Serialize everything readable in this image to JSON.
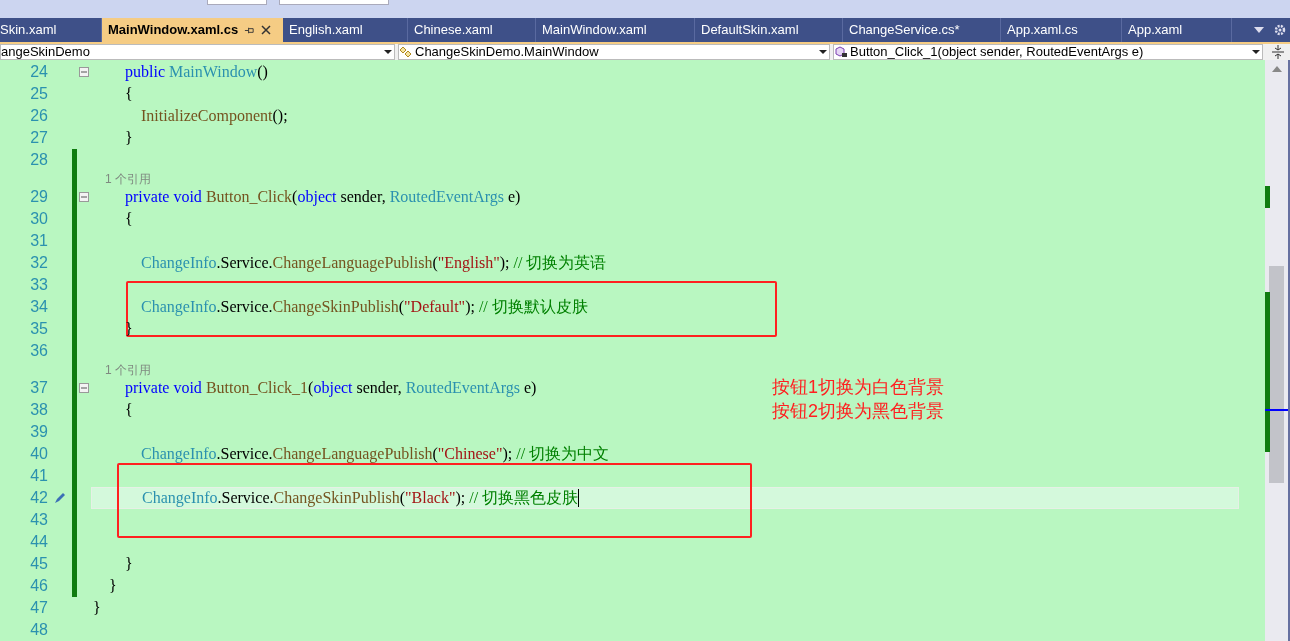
{
  "tabs": [
    {
      "label": "Skin.xaml",
      "selected": false
    },
    {
      "label": "MainWindow.xaml.cs",
      "selected": true
    },
    {
      "label": "English.xaml",
      "selected": false
    },
    {
      "label": "Chinese.xaml",
      "selected": false
    },
    {
      "label": "MainWindow.xaml",
      "selected": false
    },
    {
      "label": "DefaultSkin.xaml",
      "selected": false
    },
    {
      "label": "ChangeService.cs*",
      "selected": false
    },
    {
      "label": "App.xaml.cs",
      "selected": false
    },
    {
      "label": "App.xaml",
      "selected": false
    }
  ],
  "nav": {
    "project": "angeSkinDemo",
    "type": "ChangeSkinDemo.MainWindow",
    "member": "Button_Click_1(object sender, RoutedEventArgs e)"
  },
  "lines": [
    {
      "kind": "code",
      "number": "24",
      "fold": true,
      "tokens": [
        {
          "kind": "keyword",
          "text": "        public "
        },
        {
          "kind": "type",
          "text": "MainWindow"
        },
        {
          "kind": "plain",
          "text": "()"
        }
      ]
    },
    {
      "kind": "code",
      "number": "25",
      "tokens": [
        {
          "kind": "plain",
          "text": "        {"
        }
      ]
    },
    {
      "kind": "code",
      "number": "26",
      "tokens": [
        {
          "kind": "method",
          "text": "            InitializeComponent"
        },
        {
          "kind": "plain",
          "text": "();"
        }
      ]
    },
    {
      "kind": "code",
      "number": "27",
      "tokens": [
        {
          "kind": "plain",
          "text": "        }"
        }
      ]
    },
    {
      "kind": "code",
      "number": "28",
      "changed": true
    },
    {
      "kind": "codelens",
      "text": "1 个引用",
      "changed": true
    },
    {
      "kind": "code",
      "number": "29",
      "changed": true,
      "fold": true,
      "tokens": [
        {
          "kind": "keyword",
          "text": "        private void "
        },
        {
          "kind": "method",
          "text": "Button_Click"
        },
        {
          "kind": "plain",
          "text": "("
        },
        {
          "kind": "keyword",
          "text": "object"
        },
        {
          "kind": "plain",
          "text": " sender, "
        },
        {
          "kind": "type",
          "text": "RoutedEventArgs"
        },
        {
          "kind": "plain",
          "text": " e)"
        }
      ]
    },
    {
      "kind": "code",
      "number": "30",
      "changed": true,
      "tokens": [
        {
          "kind": "plain",
          "text": "        {"
        }
      ]
    },
    {
      "kind": "code",
      "number": "31",
      "changed": true
    },
    {
      "kind": "code",
      "number": "32",
      "changed": true,
      "tokens": [
        {
          "kind": "type",
          "text": "            ChangeInfo"
        },
        {
          "kind": "plain",
          "text": ".Service."
        },
        {
          "kind": "method",
          "text": "ChangeLanguagePublish"
        },
        {
          "kind": "plain",
          "text": "("
        },
        {
          "kind": "string",
          "text": "\"English\""
        },
        {
          "kind": "plain",
          "text": "); "
        },
        {
          "kind": "comment",
          "text": "// 切换为英语"
        }
      ]
    },
    {
      "kind": "code",
      "number": "33",
      "changed": true
    },
    {
      "kind": "code",
      "number": "34",
      "changed": true,
      "boxed": true,
      "tokens": [
        {
          "kind": "type",
          "text": "            ChangeInfo"
        },
        {
          "kind": "plain",
          "text": ".Service."
        },
        {
          "kind": "method",
          "text": "ChangeSkinPublish"
        },
        {
          "kind": "plain",
          "text": "("
        },
        {
          "kind": "string",
          "text": "\"Default\""
        },
        {
          "kind": "plain",
          "text": "); "
        },
        {
          "kind": "comment",
          "text": "// 切换默认皮肤"
        }
      ]
    },
    {
      "kind": "code",
      "number": "35",
      "changed": true,
      "tokens": [
        {
          "kind": "plain",
          "text": "        }"
        }
      ]
    },
    {
      "kind": "code",
      "number": "36",
      "changed": true
    },
    {
      "kind": "codelens",
      "text": "1 个引用",
      "changed": true
    },
    {
      "kind": "code",
      "number": "37",
      "changed": true,
      "fold": true,
      "tokens": [
        {
          "kind": "keyword",
          "text": "        private void "
        },
        {
          "kind": "method",
          "text": "Button_Click_1"
        },
        {
          "kind": "plain",
          "text": "("
        },
        {
          "kind": "keyword",
          "text": "object"
        },
        {
          "kind": "plain",
          "text": " sender, "
        },
        {
          "kind": "type",
          "text": "RoutedEventArgs"
        },
        {
          "kind": "plain",
          "text": " e)"
        }
      ]
    },
    {
      "kind": "code",
      "number": "38",
      "changed": true,
      "tokens": [
        {
          "kind": "plain",
          "text": "        {"
        }
      ]
    },
    {
      "kind": "code",
      "number": "39",
      "changed": true
    },
    {
      "kind": "code",
      "number": "40",
      "changed": true,
      "tokens": [
        {
          "kind": "type",
          "text": "            ChangeInfo"
        },
        {
          "kind": "plain",
          "text": ".Service."
        },
        {
          "kind": "method",
          "text": "ChangeLanguagePublish"
        },
        {
          "kind": "plain",
          "text": "("
        },
        {
          "kind": "string",
          "text": "\"Chinese\""
        },
        {
          "kind": "plain",
          "text": "); "
        },
        {
          "kind": "comment",
          "text": "// 切换为中文"
        }
      ]
    },
    {
      "kind": "code",
      "number": "41",
      "changed": true
    },
    {
      "kind": "code",
      "number": "42",
      "changed": true,
      "current": true,
      "boxed": true,
      "tokens": [
        {
          "kind": "type",
          "text": "            ChangeInfo"
        },
        {
          "kind": "plain",
          "text": ".Service."
        },
        {
          "kind": "method",
          "text": "ChangeSkinPublish"
        },
        {
          "kind": "plain",
          "text": "("
        },
        {
          "kind": "string",
          "text": "\"Black\""
        },
        {
          "kind": "plain",
          "text": "); "
        },
        {
          "kind": "comment",
          "text": "// 切换黑色皮肤"
        }
      ]
    },
    {
      "kind": "code",
      "number": "43",
      "changed": true
    },
    {
      "kind": "code",
      "number": "44",
      "changed": true
    },
    {
      "kind": "code",
      "number": "45",
      "changed": true,
      "tokens": [
        {
          "kind": "plain",
          "text": "        }"
        }
      ]
    },
    {
      "kind": "code",
      "number": "46",
      "changed": true,
      "tokens": [
        {
          "kind": "plain",
          "text": "    }"
        }
      ]
    },
    {
      "kind": "code",
      "number": "47",
      "tokens": [
        {
          "kind": "plain",
          "text": "}"
        }
      ]
    },
    {
      "kind": "code",
      "number": "48"
    }
  ],
  "note": [
    "按钮1切换为白色背景",
    "按钮2切换为黑色背景"
  ]
}
